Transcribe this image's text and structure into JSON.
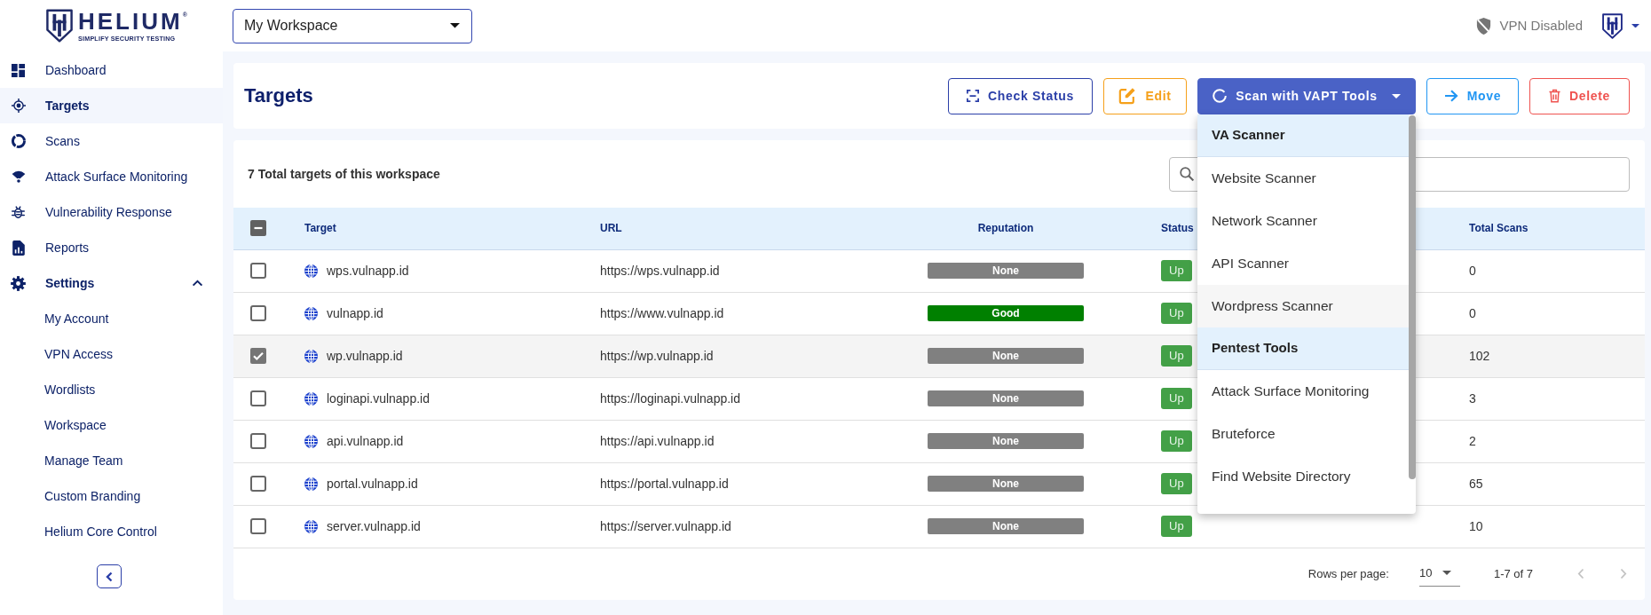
{
  "header": {
    "logo": {
      "name": "HELIUM$^{®}$",
      "tagline": "SIMPLIFY SECURITY TESTING"
    },
    "workspace": {
      "value": "My Workspace"
    },
    "vpn": {
      "label": "VPN Disabled"
    }
  },
  "sidebar": {
    "items": [
      {
        "label": "Dashboard",
        "selected": false
      },
      {
        "label": "Targets",
        "selected": true
      },
      {
        "label": "Scans",
        "selected": false
      },
      {
        "label": "Attack Surface Monitoring",
        "selected": false
      },
      {
        "label": "Vulnerability Response",
        "selected": false
      },
      {
        "label": "Reports",
        "selected": false
      },
      {
        "label": "Settings",
        "selected": false,
        "expanded": true,
        "children": [
          {
            "label": "My Account",
            "selected": false
          },
          {
            "label": "VPN Access",
            "selected": false
          },
          {
            "label": "Wordlists",
            "selected": false
          },
          {
            "label": "Workspace",
            "selected": false
          },
          {
            "label": "Manage Team",
            "selected": false
          },
          {
            "label": "Custom Branding",
            "selected": false
          },
          {
            "label": "Helium Core Control",
            "selected": false
          }
        ]
      }
    ]
  },
  "page": {
    "title": "Targets",
    "actions": [
      {
        "label": "Check Status"
      },
      {
        "label": "Edit"
      },
      {
        "label": "Scan with VAPT Tools",
        "expanded": true,
        "menu": {
          "groups": [
            {
              "heading": "VA Scanner",
              "items": [
                {
                  "label": "Website Scanner",
                  "hovered": false
                },
                {
                  "label": "Network Scanner",
                  "hovered": false
                },
                {
                  "label": "API Scanner",
                  "hovered": false
                },
                {
                  "label": "Wordpress Scanner",
                  "hovered": true
                }
              ]
            },
            {
              "heading": "Pentest Tools",
              "items": [
                {
                  "label": "Attack Surface Monitoring",
                  "hovered": false
                },
                {
                  "label": "Bruteforce",
                  "hovered": false
                },
                {
                  "label": "Find Website Directory",
                  "hovered": false
                }
              ]
            }
          ]
        }
      },
      {
        "label": "Move"
      },
      {
        "label": "Delete"
      }
    ]
  },
  "targets_table": {
    "summary": "7 Total targets of this workspace",
    "select_all": {
      "indeterminate": true
    },
    "columns": [
      "Target",
      "URL",
      "Reputation",
      "Status",
      "Total Scans"
    ],
    "rows": [
      {
        "checked": false,
        "target": "wps.vulnapp.id",
        "url": "https://wps.vulnapp.id",
        "reputation": {
          "label": "None",
          "color": "#808080"
        },
        "status": "Up",
        "total_scans": "0"
      },
      {
        "checked": false,
        "target": "vulnapp.id",
        "url": "https://www.vulnapp.id",
        "reputation": {
          "label": "Good",
          "color": "#008000"
        },
        "status": "Up",
        "total_scans": "0"
      },
      {
        "checked": true,
        "target": "wp.vulnapp.id",
        "url": "https://wp.vulnapp.id",
        "reputation": {
          "label": "None",
          "color": "#808080"
        },
        "status": "Up",
        "total_scans": "102"
      },
      {
        "checked": false,
        "target": "loginapi.vulnapp.id",
        "url": "https://loginapi.vulnapp.id",
        "reputation": {
          "label": "None",
          "color": "#808080"
        },
        "status": "Up",
        "total_scans": "3"
      },
      {
        "checked": false,
        "target": "api.vulnapp.id",
        "url": "https://api.vulnapp.id",
        "reputation": {
          "label": "None",
          "color": "#808080"
        },
        "status": "Up",
        "total_scans": "2"
      },
      {
        "checked": false,
        "target": "portal.vulnapp.id",
        "url": "https://portal.vulnapp.id",
        "reputation": {
          "label": "None",
          "color": "#808080"
        },
        "status": "Up",
        "total_scans": "65"
      },
      {
        "checked": false,
        "target": "server.vulnapp.id",
        "url": "https://server.vulnapp.id",
        "reputation": {
          "label": "None",
          "color": "#808080"
        },
        "status": "Up",
        "total_scans": "10"
      }
    ],
    "pagination": {
      "label": "Rows per page:",
      "rows_per_page": "10",
      "range": "1-7 of 7",
      "previous_disabled": true,
      "next_disabled": true
    }
  }
}
